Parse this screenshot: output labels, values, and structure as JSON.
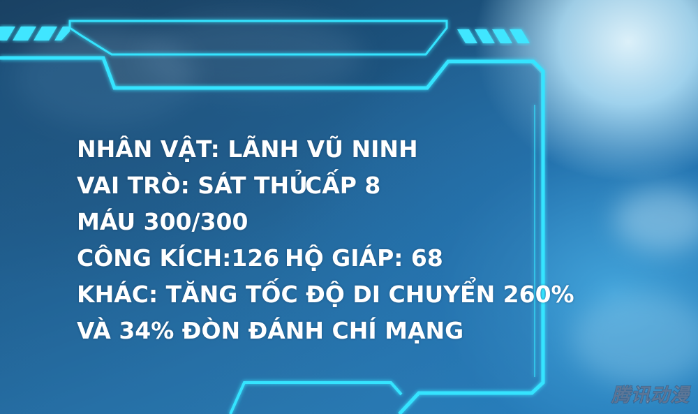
{
  "character": {
    "name_line": "NHÂN VẬT: LÃNH VŨ NINH",
    "role_line": "VAI TRÒ: SÁT THỦ",
    "level_line": "CẤP 8",
    "hp_line": "MÁU 300/300",
    "attack_line": "CÔNG KÍCH:126",
    "armor_line": "HỘ GIÁP: 68",
    "other_line": "KHÁC: TĂNG TỐC ĐỘ DI CHUYỂN 260%",
    "other_line_2": "VÀ 34% ĐÒN ĐÁNH CHÍ MẠNG"
  },
  "watermark": "腾讯动漫",
  "colors": {
    "frame_glow": "#2fe0ff",
    "panel_fill": "#1a5a8c",
    "text": "#ffffff"
  }
}
